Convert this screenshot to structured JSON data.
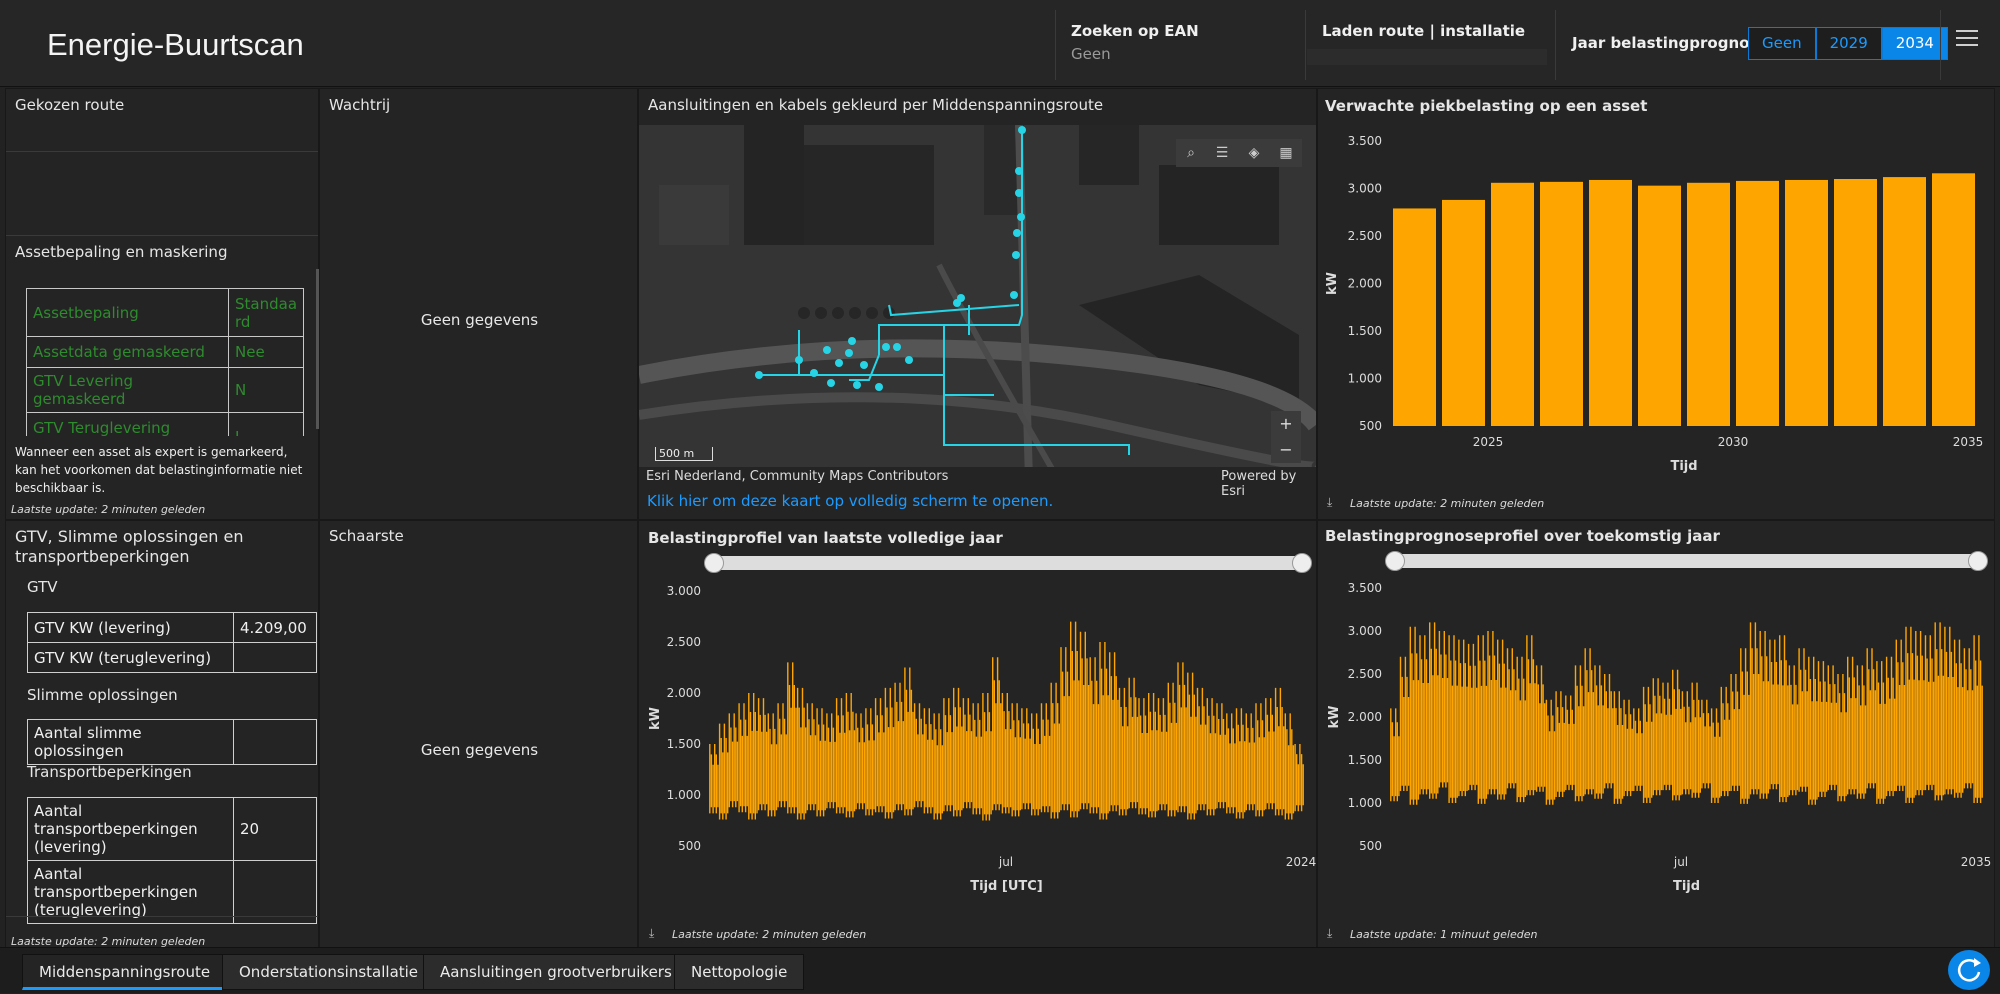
{
  "header": {
    "title": "Energie-Buurtscan",
    "ean_label": "Zoeken op EAN",
    "ean_value": "Geen",
    "route_label": "Laden route | installatie",
    "year_label": "Jaar belastingprognose",
    "year_options": [
      "Geen",
      "2029",
      "2034"
    ],
    "year_selected": "2034"
  },
  "left_top": {
    "chosen_route_label": "Gekozen route",
    "asset_section_title": "Assetbepaling en maskering",
    "asset_table": [
      [
        "Assetbepaling",
        "Standaard"
      ],
      [
        "Assetdata gemaskeerd",
        "Nee"
      ],
      [
        "GTV Levering gemaskeerd",
        "N"
      ],
      [
        "GTV Teruglevering gemaskeerd",
        "J"
      ]
    ],
    "note": "Wanneer een asset als expert is gemarkeerd, kan het voorkomen dat belastinginformatie niet beschikbaar is.",
    "update": "Laatste update: 2 minuten geleden"
  },
  "left_bottom": {
    "title": "GTV, Slimme oplossingen en transportbeperkingen",
    "gtv_heading": "GTV",
    "gtv_rows": [
      [
        "GTV KW (levering)",
        "4.209,00"
      ],
      [
        "GTV KW (teruglevering)",
        ""
      ]
    ],
    "smart_heading": "Slimme oplossingen",
    "smart_rows": [
      [
        "Aantal slimme oplossingen",
        ""
      ]
    ],
    "transport_heading": "Transportbeperkingen",
    "transport_rows": [
      [
        "Aantal transportbeperkingen (levering)",
        "20"
      ],
      [
        "Aantal transportbeperkingen (teruglevering)",
        ""
      ]
    ],
    "update": "Laatste update: 2 minuten geleden"
  },
  "queue": {
    "title": "Wachtrij",
    "no_data": "Geen gegevens"
  },
  "scarcity": {
    "title": "Schaarste",
    "no_data": "Geen gegevens"
  },
  "map": {
    "title": "Aansluitingen en kabels gekleurd per Middenspanningsroute",
    "scale": "500 m",
    "attribution": "Esri Nederland, Community Maps Contributors",
    "powered": "Powered by Esri",
    "link": "Klik hier om deze kaart op volledig scherm te openen.",
    "zoom_in": "+",
    "zoom_out": "−",
    "tools": [
      "search-icon",
      "list-icon",
      "layers-icon",
      "basemap-icon"
    ],
    "cable_color": "#27d4e6"
  },
  "bar_panel": {
    "title": "Verwachte piekbelasting op een asset",
    "update": "Laatste update: 2 minuten geleden"
  },
  "profile_panel": {
    "title": "Belastingprofiel van laatste volledige jaar",
    "update": "Laatste update: 2 minuten geleden"
  },
  "forecast_panel": {
    "title": "Belastingprognoseprofiel over toekomstig jaar",
    "update": "Laatste update: 1 minuut geleden"
  },
  "chart_data": [
    {
      "type": "bar",
      "xlabel": "Tijd",
      "ylabel": "kW",
      "categories": [
        2024,
        2025,
        2026,
        2027,
        2028,
        2029,
        2030,
        2031,
        2032,
        2033,
        2034,
        2035
      ],
      "values": [
        2790,
        2880,
        3060,
        3070,
        3090,
        3030,
        3060,
        3080,
        3090,
        3100,
        3120,
        3160
      ],
      "ylim": [
        500,
        3500
      ],
      "yticks": [
        "500",
        "1.000",
        "1.500",
        "2.000",
        "2.500",
        "3.000",
        "3.500"
      ],
      "xticks": [
        "2025",
        "2030",
        "2035"
      ],
      "color": "#ffa500",
      "grid": false
    },
    {
      "type": "area",
      "xlabel": "Tijd [UTC]",
      "ylabel": "kW",
      "ylim": [
        500,
        3000
      ],
      "yticks": [
        "500",
        "1.000",
        "1.500",
        "2.000",
        "2.500",
        "3.000"
      ],
      "xticks": [
        "jul",
        "2024"
      ],
      "color": "#ffa500",
      "series": [
        {
          "values": [
            1500,
            1700,
            1800,
            1900,
            2000,
            1950,
            1800,
            1900,
            2300,
            2050,
            1900,
            1850,
            1800,
            1950,
            2000,
            1800,
            1850,
            1950,
            2050,
            2100,
            2250,
            1900,
            1850,
            1800,
            1950,
            2050,
            1950,
            1900,
            2000,
            2350,
            2000,
            1900,
            1850,
            1800,
            1900,
            2100,
            2450,
            2700,
            2600,
            2350,
            2500,
            2400,
            2050,
            2150,
            1950,
            2000,
            1950,
            2100,
            2300,
            2200,
            2050,
            1950,
            1900,
            1800,
            1850,
            1800,
            1900,
            1950,
            2050,
            1800,
            1500
          ]
        }
      ],
      "base": [
        820,
        760,
        880,
        830,
        760,
        850,
        790,
        880,
        820,
        760,
        850,
        790,
        870,
        820,
        780,
        860,
        800,
        830,
        770,
        850,
        800,
        880,
        820,
        760,
        840,
        790,
        870,
        810,
        750,
        850,
        820,
        790,
        860,
        800,
        830,
        770,
        850,
        780,
        860,
        820,
        760,
        840,
        800,
        870,
        810,
        780,
        850,
        790,
        830,
        760,
        850,
        800,
        870,
        820,
        770,
        850,
        790,
        860,
        800,
        760,
        840
      ]
    },
    {
      "type": "area",
      "xlabel": "Tijd",
      "ylabel": "kW",
      "ylim": [
        500,
        3500
      ],
      "yticks": [
        "500",
        "1.000",
        "1.500",
        "2.000",
        "2.500",
        "3.000",
        "3.500"
      ],
      "xticks": [
        "jul",
        "2035"
      ],
      "color": "#ffa500",
      "series": [
        {
          "values": [
            2100,
            2700,
            3050,
            2950,
            3100,
            3000,
            2950,
            2900,
            2850,
            2950,
            3000,
            2900,
            2800,
            2700,
            2950,
            2600,
            2200,
            2300,
            2250,
            2600,
            2800,
            2600,
            2500,
            2300,
            2200,
            2100,
            2350,
            2450,
            2400,
            2550,
            2300,
            2400,
            2200,
            2100,
            2350,
            2500,
            2800,
            3100,
            3000,
            2900,
            2950,
            2600,
            2800,
            2700,
            2650,
            2600,
            2500,
            2700,
            2600,
            2800,
            2650,
            2700,
            2900,
            3050,
            3000,
            2950,
            3100,
            3050,
            2900,
            2800,
            2950
          ]
        }
      ],
      "base": [
        1020,
        1140,
        980,
        1100,
        1050,
        1180,
        1000,
        1080,
        1150,
        990,
        1100,
        1040,
        1170,
        1010,
        1090,
        1130,
        980,
        1070,
        1150,
        1020,
        1100,
        1050,
        1170,
        990,
        1080,
        1140,
        1000,
        1090,
        1150,
        1030,
        1100,
        1060,
        1170,
        1000,
        1080,
        1140,
        990,
        1100,
        1050,
        1160,
        1010,
        1090,
        1130,
        980,
        1070,
        1150,
        1020,
        1100,
        1050,
        1170,
        990,
        1080,
        1140,
        1000,
        1090,
        1150,
        1030,
        1100,
        1060,
        1170,
        1000
      ]
    }
  ],
  "tabs": [
    "Middenspanningsroute",
    "Onderstationsinstallatie",
    "Aansluitingen grootverbruikers",
    "Nettopologie"
  ]
}
